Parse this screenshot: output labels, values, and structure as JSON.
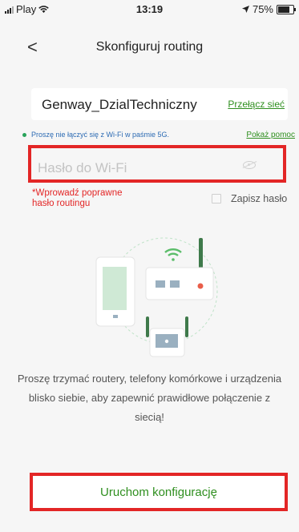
{
  "status_bar": {
    "carrier": "Play",
    "time": "13:19",
    "battery": "75%",
    "battery_level": 0.75
  },
  "nav": {
    "back": "<",
    "title": "Skonfiguruj routing"
  },
  "network": {
    "ssid": "Genway_DzialTechniczny",
    "switch_label": "Przełącz sieć"
  },
  "hint": {
    "text": "Proszę nie łączyć się z Wi-Fi w paśmie 5G.",
    "help_link": "Pokaż pomoc"
  },
  "password": {
    "placeholder": "Hasło do Wi-Fi",
    "error": "*Wprowadź poprawne hasło routingu",
    "save_label": "Zapisz hasło"
  },
  "info": {
    "text": "Proszę trzymać routery, telefony komórkowe i urządzenia blisko siebie, aby zapewnić prawidłowe połączenie z siecią!"
  },
  "actions": {
    "start_label": "Uruchom konfigurację"
  },
  "colors": {
    "accent": "#2f8f1f",
    "error": "#e32626",
    "background": "#f6f6f6"
  }
}
